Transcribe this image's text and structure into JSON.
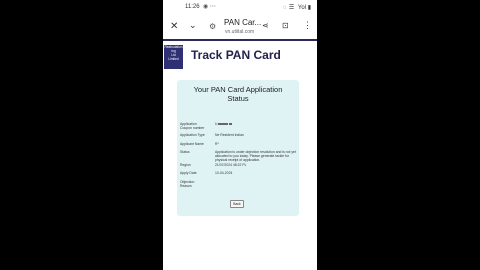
{
  "status_bar": {
    "time": "11:26",
    "right": "◌  ☰   Yol ▮"
  },
  "browser": {
    "tab_title": "PAN Car...",
    "domain": "vn.utiital.com",
    "icons": {
      "close": "close-icon",
      "chevron": "chevron-down-icon",
      "tune": "tune-icon",
      "share": "share-icon",
      "bookmark": "bookmark-icon",
      "more": "more-vertical-icon"
    }
  },
  "header": {
    "title": "Track PAN Card",
    "logo_lines": [
      "Reabudation",
      "Ing",
      "Ltd",
      "Limited"
    ]
  },
  "card": {
    "title_line1": "Your PAN Card Application",
    "title_line2": "Status",
    "fields": [
      {
        "label": "Application Coupon number",
        "value": "U"
      },
      {
        "label": "Application Type",
        "value": "Ne                   Resident Indian"
      },
      {
        "label": "Applicant Name",
        "value": "R*"
      },
      {
        "label": "Status",
        "value": "Application is under objection resolution and is not yet allocated to you today. Please generate tackle for physical receipt of application."
      },
      {
        "label": "Region",
        "value": "21/07/2024 48:22 PL"
      },
      {
        "label": "Apply Date",
        "value": "10-04-2024"
      },
      {
        "label": "Objection Reason",
        "value": ""
      }
    ],
    "back_label": "Back"
  },
  "colors": {
    "page_bg": "#000000",
    "card_bg": "#dff3f4",
    "brand": "#2f2f73"
  }
}
